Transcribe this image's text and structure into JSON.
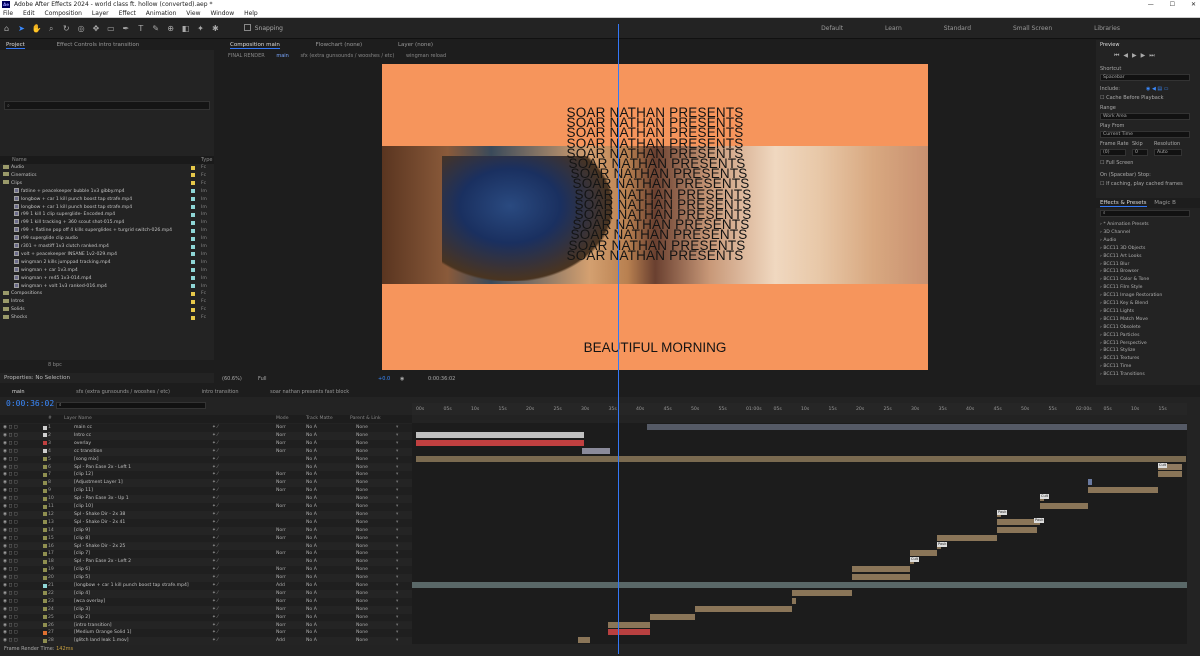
{
  "window": {
    "title": "Adobe After Effects 2024 - world class ft. hollow (converted).aep *",
    "app_icon": "Ae"
  },
  "window_controls": {
    "minimize": "—",
    "maximize": "☐",
    "close": "✕"
  },
  "menu": [
    "File",
    "Edit",
    "Composition",
    "Layer",
    "Effect",
    "Animation",
    "View",
    "Window",
    "Help"
  ],
  "toolbar": {
    "snapping": "Snapping",
    "workspaces": [
      "Default",
      "Learn",
      "Standard",
      "Small Screen",
      "Libraries"
    ]
  },
  "project_panel": {
    "tabs": [
      "Project",
      "Effect Controls intro transition"
    ],
    "search_placeholder": "",
    "columns": {
      "name": "Name",
      "type": "Type"
    },
    "items": [
      {
        "name": "Audio",
        "kind": "folder",
        "indent": 0,
        "type": "Fc",
        "color": "#e6c84a"
      },
      {
        "name": "Cinematics",
        "kind": "folder",
        "indent": 0,
        "type": "Fc",
        "color": "#e6c84a"
      },
      {
        "name": "Clips",
        "kind": "folder",
        "indent": 0,
        "type": "Fc",
        "color": "#e6c84a"
      },
      {
        "name": "fatline + peacekeeper bubble 1v3 gibby.mp4",
        "kind": "file",
        "indent": 1,
        "type": "Im",
        "color": "#8fd6d6"
      },
      {
        "name": "longbow + car 1 kill punch boost tap strafe.mp4",
        "kind": "file",
        "indent": 1,
        "type": "Im",
        "color": "#8fd6d6"
      },
      {
        "name": "longbow + car 1 kill punch boost tap strafe.mp4",
        "kind": "file",
        "indent": 1,
        "type": "Im",
        "color": "#8fd6d6"
      },
      {
        "name": "r99 1 kill 1 clip superglide- Encoded.mp4",
        "kind": "file",
        "indent": 1,
        "type": "Im",
        "color": "#8fd6d6"
      },
      {
        "name": "r99 1 kill tracking + 360 scout shot-015.mp4",
        "kind": "file",
        "indent": 1,
        "type": "Im",
        "color": "#8fd6d6"
      },
      {
        "name": "r99 + flatline pop off 4 kills superglides + turgrid switch-026.mp4",
        "kind": "file",
        "indent": 1,
        "type": "Im",
        "color": "#8fd6d6"
      },
      {
        "name": "r99 superglide clip audio",
        "kind": "file",
        "indent": 1,
        "type": "Im",
        "color": "#8fd6d6"
      },
      {
        "name": "r301 + mastiff 1v3 clutch ranked.mp4",
        "kind": "file",
        "indent": 1,
        "type": "Im",
        "color": "#8fd6d6"
      },
      {
        "name": "volt + peacekeeper INSANE 1v2-029.mp4",
        "kind": "file",
        "indent": 1,
        "type": "Im",
        "color": "#8fd6d6"
      },
      {
        "name": "wingman 2 kills jumppad tracking.mp4",
        "kind": "file",
        "indent": 1,
        "type": "Im",
        "color": "#8fd6d6"
      },
      {
        "name": "wingman + car 1v3.mp4",
        "kind": "file",
        "indent": 1,
        "type": "Im",
        "color": "#8fd6d6"
      },
      {
        "name": "wingman + re45 1v3-014.mp4",
        "kind": "file",
        "indent": 1,
        "type": "Im",
        "color": "#8fd6d6"
      },
      {
        "name": "wingman + volt 1v3 ranked-016.mp4",
        "kind": "file",
        "indent": 1,
        "type": "Im",
        "color": "#8fd6d6"
      },
      {
        "name": "Compositions",
        "kind": "folder",
        "indent": 0,
        "type": "Fc",
        "color": "#e6c84a"
      },
      {
        "name": "Intros",
        "kind": "folder",
        "indent": 0,
        "type": "Fc",
        "color": "#e6c84a"
      },
      {
        "name": "Solids",
        "kind": "folder",
        "indent": 0,
        "type": "Fc",
        "color": "#e6c84a"
      },
      {
        "name": "Shocks",
        "kind": "folder",
        "indent": 0,
        "type": "Fc",
        "color": "#e6c84a"
      }
    ],
    "footer": "8 bpc"
  },
  "properties": {
    "label": "Properties: No Selection"
  },
  "composition": {
    "tabs": [
      "Composition main",
      "Flowchart (none)",
      "Layer (none)"
    ],
    "breadcrumb": [
      "FINAL RENDER",
      "main",
      "sfx (extra gunsounds / wooshes / etc)",
      "wingman reload"
    ],
    "presents_text": "SOAR NATHAN PRESENTS",
    "bottom_text": "BEAUTIFUL MORNING",
    "zoom": "(60.6%)",
    "quality": "Full",
    "exposure": "+0.0",
    "timecode": "0:00:36:02",
    "accent": "#f6955c"
  },
  "preview": {
    "title": "Preview",
    "shortcut_label": "Shortcut",
    "shortcut": "Spacebar",
    "include": "Include:",
    "cache_before": "Cache Before Playback",
    "range_label": "Range",
    "range": "Work Area",
    "play_from_label": "Play From",
    "play_from": "Current Time",
    "frame_rate_label": "Frame Rate",
    "skip_label": "Skip",
    "resolution_label": "Resolution",
    "frame_rate": "(0)",
    "skip": "0",
    "resolution": "Auto",
    "full_screen": "Full Screen",
    "on_stop": "On (Spacebar) Stop:",
    "if_caching": "If caching, play cached frames"
  },
  "effects": {
    "tabs": [
      "Effects & Presets",
      "Magic B"
    ],
    "items": [
      "* Animation Presets",
      "3D Channel",
      "Audio",
      "BCC11 3D Objects",
      "BCC11 Art Looks",
      "BCC11 Blur",
      "BCC11 Browser",
      "BCC11 Color & Tone",
      "BCC11 Film Style",
      "BCC11 Image Restoration",
      "BCC11 Key & Blend",
      "BCC11 Lights",
      "BCC11 Match Move",
      "BCC11 Obsolete",
      "BCC11 Particles",
      "BCC11 Perspective",
      "BCC11 Stylize",
      "BCC11 Textures",
      "BCC11 Time",
      "BCC11 Transitions"
    ]
  },
  "timeline": {
    "tabs": [
      "main",
      "sfx (extra gunsounds / wooshes / etc)",
      "intro transition",
      "soar nathan presents fast block"
    ],
    "timecode": "0:00:36:02",
    "columns": {
      "layer_name": "Layer Name",
      "mode": "Mode",
      "trkmat": "Track Matte",
      "parent": "Parent & Link",
      "num": "#"
    },
    "ruler": [
      "00s",
      "05s",
      "10s",
      "15s",
      "20s",
      "25s",
      "30s",
      "35s",
      "40s",
      "45s",
      "50s",
      "55s",
      "01:00s",
      "05s",
      "10s",
      "15s",
      "20s",
      "25s",
      "30s",
      "35s",
      "40s",
      "45s",
      "50s",
      "55s",
      "02:00s",
      "05s",
      "10s",
      "15s"
    ],
    "layers": [
      {
        "n": "1",
        "name": "main cc",
        "color": "#cfcfcf",
        "mode": "Norr"
      },
      {
        "n": "2",
        "name": "Intro cc",
        "color": "#cfcfcf",
        "mode": "Norr"
      },
      {
        "n": "3",
        "name": "overlay",
        "color": "#c04040",
        "mode": "Norr"
      },
      {
        "n": "4",
        "name": "cc transition",
        "color": "#cfcfcf",
        "mode": "Norr"
      },
      {
        "n": "5",
        "name": "[song mix]",
        "color": "#8f8f50",
        "mode": ""
      },
      {
        "n": "6",
        "name": "Spl - Pan Ease 2x - Left 1",
        "color": "#8f8f50",
        "mode": ""
      },
      {
        "n": "7",
        "name": "[clip 12]",
        "color": "#8f8f50",
        "mode": "Norr"
      },
      {
        "n": "8",
        "name": "[Adjustment Layer 1]",
        "color": "#8f8f50",
        "mode": "Norr"
      },
      {
        "n": "9",
        "name": "[clip 11]",
        "color": "#8f8f50",
        "mode": "Norr"
      },
      {
        "n": "10",
        "name": "Spl - Pan Ease 3x - Up 1",
        "color": "#8f8f50",
        "mode": ""
      },
      {
        "n": "11",
        "name": "[clip 10]",
        "color": "#8f8f50",
        "mode": "Norr"
      },
      {
        "n": "12",
        "name": "Spl - Shake Dir - 2x 38",
        "color": "#8f8f50",
        "mode": ""
      },
      {
        "n": "13",
        "name": "Spl - Shake Dir - 2x 41",
        "color": "#8f8f50",
        "mode": ""
      },
      {
        "n": "14",
        "name": "[clip 9]",
        "color": "#8f8f50",
        "mode": "Norr"
      },
      {
        "n": "15",
        "name": "[clip 8]",
        "color": "#8f8f50",
        "mode": "Norr"
      },
      {
        "n": "16",
        "name": "Spl - Shake Dir - 2x 25",
        "color": "#8f8f50",
        "mode": ""
      },
      {
        "n": "17",
        "name": "[clip 7]",
        "color": "#8f8f50",
        "mode": "Norr"
      },
      {
        "n": "18",
        "name": "Spl - Pan Ease 2x - Left 2",
        "color": "#8f8f50",
        "mode": ""
      },
      {
        "n": "19",
        "name": "[clip 6]",
        "color": "#8f8f50",
        "mode": "Norr"
      },
      {
        "n": "20",
        "name": "[clip 5]",
        "color": "#8f8f50",
        "mode": "Norr"
      },
      {
        "n": "21",
        "name": "[longbow + car 1 kill punch boost tap strafe.mp4]",
        "color": "#8fd6d6",
        "mode": "Add"
      },
      {
        "n": "22",
        "name": "[clip 4]",
        "color": "#8f8f50",
        "mode": "Norr"
      },
      {
        "n": "23",
        "name": "[wca overlay]",
        "color": "#8f8f50",
        "mode": "Norr"
      },
      {
        "n": "24",
        "name": "[clip 3]",
        "color": "#8f8f50",
        "mode": "Norr"
      },
      {
        "n": "25",
        "name": "[clip 2]",
        "color": "#8f8f50",
        "mode": "Norr"
      },
      {
        "n": "26",
        "name": "[intro transition]",
        "color": "#8f8f50",
        "mode": "Norr"
      },
      {
        "n": "27",
        "name": "[Medium Orange Solid 1]",
        "color": "#e07030",
        "mode": "Norr"
      },
      {
        "n": "28",
        "name": "[glitch land leak 1.mov]",
        "color": "#8f8f50",
        "mode": "Add"
      }
    ],
    "trkmat_value": "No A",
    "parent_value": "None",
    "markers": [
      "Cult",
      "Cult",
      "Pauk",
      "Pauk",
      "Pauk",
      "Cult"
    ],
    "frame_render_label": "Frame Render Time:",
    "frame_render_value": "142ms"
  }
}
